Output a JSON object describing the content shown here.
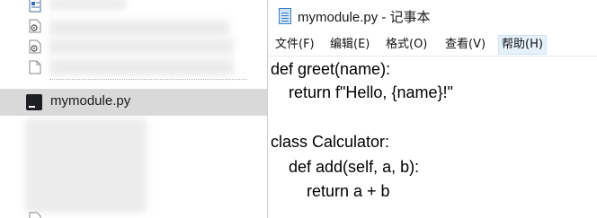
{
  "explorer": {
    "selected_file": "mymodule.py"
  },
  "notepad": {
    "title": "mymodule.py - 记事本",
    "menu": [
      "文件(F)",
      "编辑(E)",
      "格式(O)",
      "查看(V)",
      "帮助(H)"
    ],
    "code": [
      "def greet(name):",
      "    return f\"Hello, {name}!\"",
      "",
      "class Calculator:",
      "    def add(self, a, b):",
      "        return a + b"
    ]
  }
}
